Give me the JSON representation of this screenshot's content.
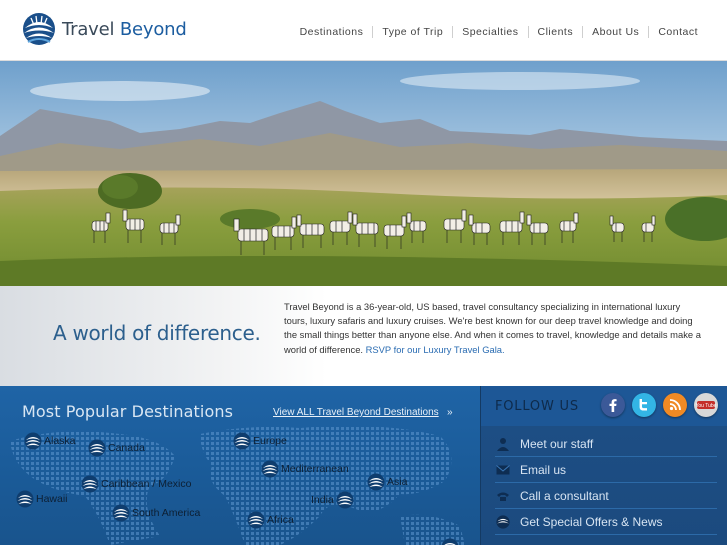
{
  "brand": {
    "word1": "Travel",
    "word2": "Beyond"
  },
  "nav": [
    "Destinations",
    "Type of Trip",
    "Specialties",
    "Clients",
    "About Us",
    "Contact"
  ],
  "tagline": "A world of difference.",
  "intro": {
    "text": "Travel Beyond is a 36-year-old, US based, travel consultancy specializing in international luxury tours, luxury safaris and luxury cruises. We're best known for our deep travel knowledge and doing the small things better than anyone else. And when it comes to travel, knowledge and details make a world of difference.",
    "link": "RSVP for our Luxury Travel Gala."
  },
  "destinations": {
    "title": "Most Popular Destinations",
    "view_all": "View ALL Travel Beyond Destinations",
    "view_all_arrow": "»",
    "items": [
      "Alaska",
      "Canada",
      "Europe",
      "Mediterranean",
      "Asia",
      "Caribbean / Mexico",
      "Hawaii",
      "South America",
      "Africa",
      "India"
    ]
  },
  "follow": {
    "title": "FOLLOW US",
    "social": [
      "facebook-icon",
      "twitter-icon",
      "rss-icon",
      "youtube-icon"
    ],
    "youtube_label": "You Tube",
    "links": [
      "Meet our staff",
      "Email us",
      "Call a consultant",
      "Get Special Offers & News"
    ]
  },
  "colors": {
    "brand_blue": "#1c5da0",
    "panel_blue": "#1f64a6",
    "follow_blue": "#1e4f86",
    "facebook": "#3b5998",
    "twitter": "#33b5e5",
    "rss": "#f08a24",
    "youtube": "#d8d8d8"
  }
}
